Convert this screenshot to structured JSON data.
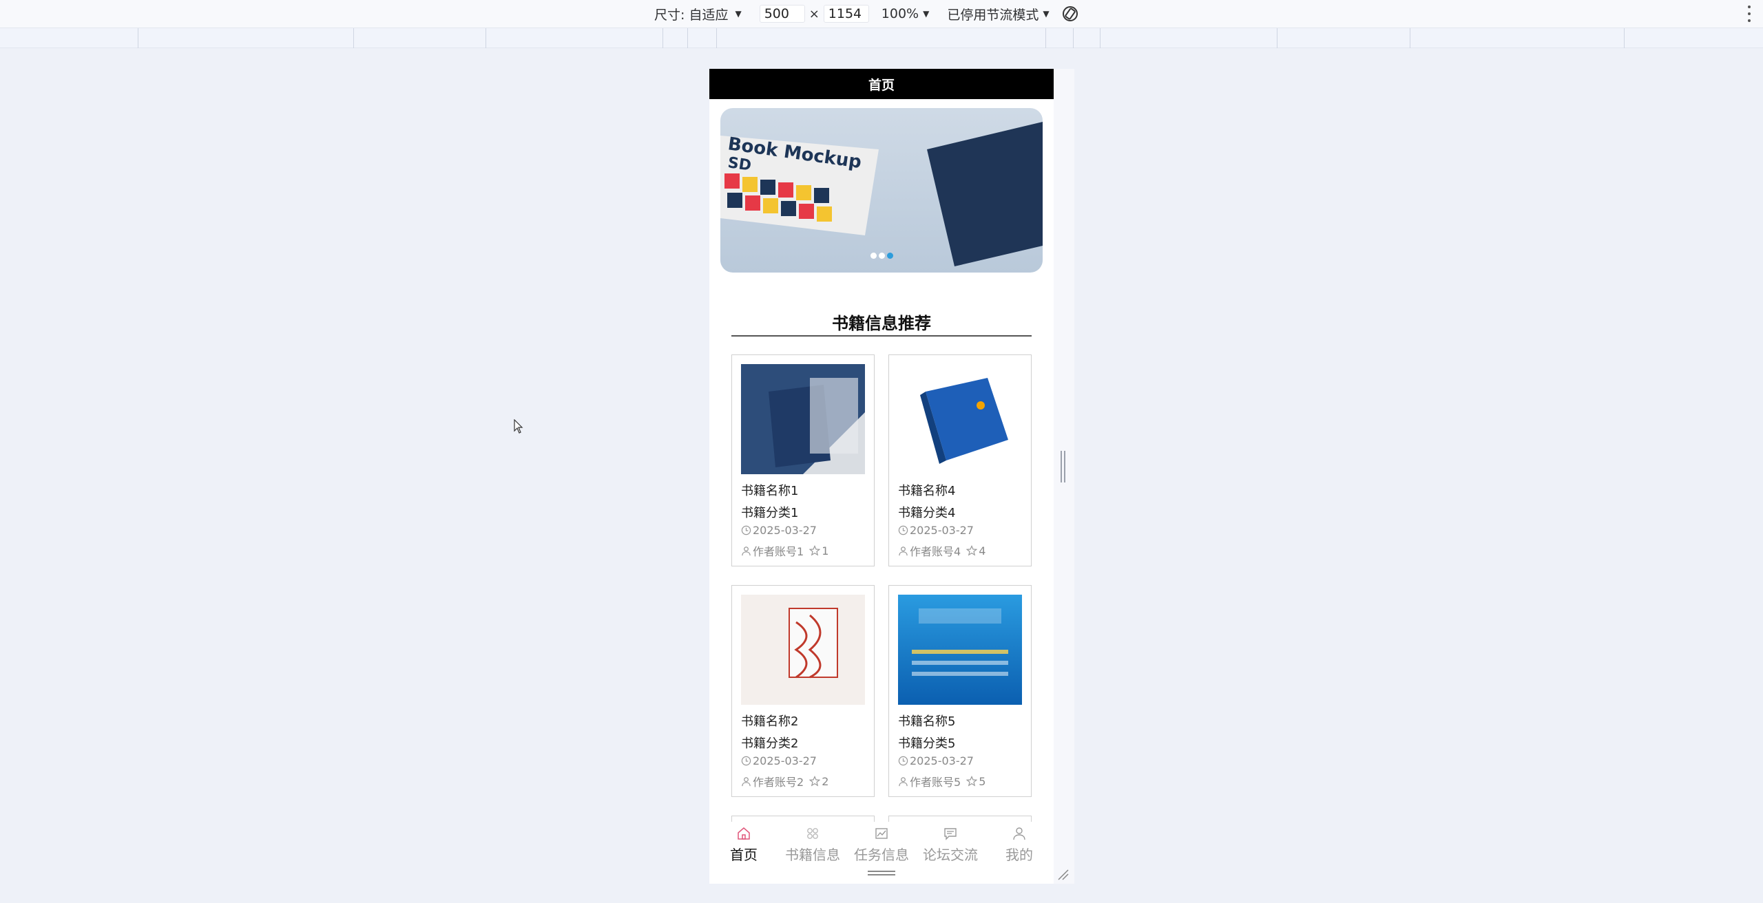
{
  "devtools": {
    "size_label": "尺寸: 自适应",
    "width_value": "500",
    "times": "×",
    "height_value": "1154",
    "zoom": "100%",
    "throttle": "已停用节流模式"
  },
  "page": {
    "title": "首页",
    "section_title": "书籍信息推荐"
  },
  "banner": {
    "active_slide_index": 2,
    "slide_count": 3
  },
  "books": [
    {
      "name": "书籍名称1",
      "category": "书籍分类1",
      "date": "2025-03-27",
      "author": "作者账号1",
      "stars": "1"
    },
    {
      "name": "书籍名称4",
      "category": "书籍分类4",
      "date": "2025-03-27",
      "author": "作者账号4",
      "stars": "4"
    },
    {
      "name": "书籍名称2",
      "category": "书籍分类2",
      "date": "2025-03-27",
      "author": "作者账号2",
      "stars": "2"
    },
    {
      "name": "书籍名称5",
      "category": "书籍分类5",
      "date": "2025-03-27",
      "author": "作者账号5",
      "stars": "5"
    }
  ],
  "tabs": [
    {
      "label": "首页",
      "icon": "home-icon",
      "active": true
    },
    {
      "label": "书籍信息",
      "icon": "apps-icon",
      "active": false
    },
    {
      "label": "任务信息",
      "icon": "chart-icon",
      "active": false
    },
    {
      "label": "论坛交流",
      "icon": "chat-icon",
      "active": false
    },
    {
      "label": "我的",
      "icon": "user-icon",
      "active": false
    }
  ],
  "colors": {
    "topbar": "#000000",
    "active_dot": "#2d9cdb",
    "active_tab_icon": "#e0567a",
    "page_bg": "#eef1f8"
  }
}
